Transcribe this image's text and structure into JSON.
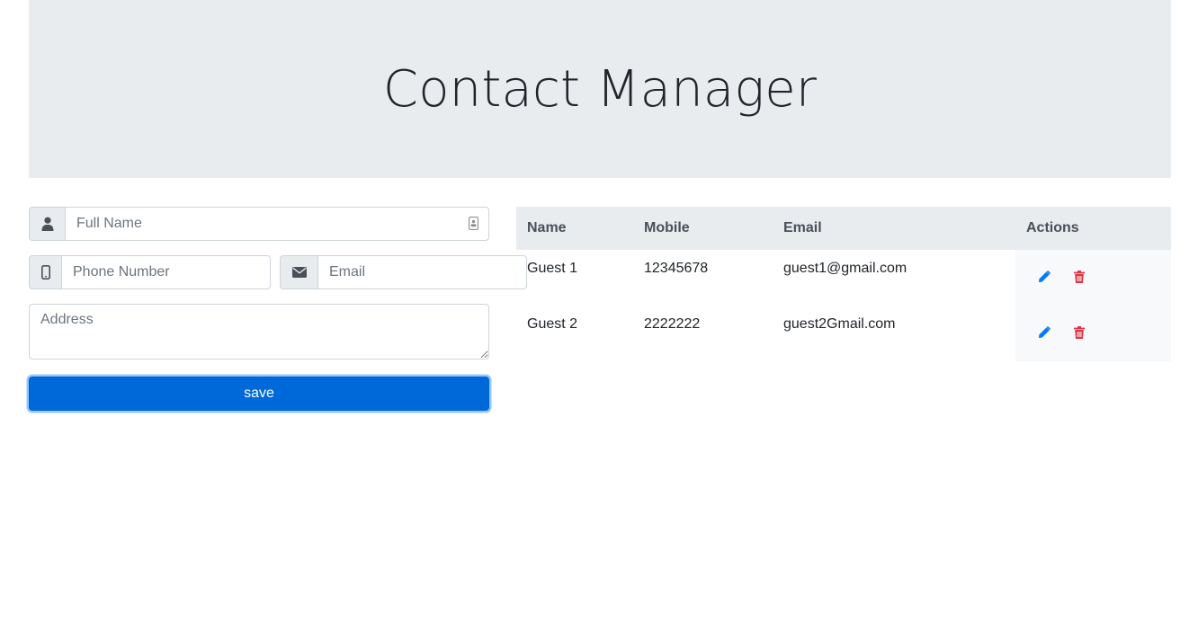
{
  "header": {
    "title": "Contact Manager"
  },
  "form": {
    "full_name_placeholder": "Full Name",
    "phone_placeholder": "Phone Number",
    "email_placeholder": "Email",
    "address_placeholder": "Address",
    "save_label": "save"
  },
  "table": {
    "headers": [
      "Name",
      "Mobile",
      "Email",
      "Actions"
    ],
    "rows": [
      {
        "name": "Guest 1",
        "mobile": "12345678",
        "email": "guest1@gmail.com"
      },
      {
        "name": "Guest 2",
        "mobile": "2222222",
        "email": "guest2Gmail.com"
      }
    ]
  },
  "colors": {
    "primary": "#0069d9",
    "danger": "#dc3545",
    "edit": "#007bff",
    "jumbotron_bg": "#e9ecef"
  },
  "icons": {
    "full_name_addon": "user-icon",
    "full_name_trailing": "contact-card-icon",
    "phone_addon": "mobile-phone-icon",
    "email_addon": "envelope-icon",
    "edit": "pencil-icon",
    "delete": "trash-icon"
  }
}
